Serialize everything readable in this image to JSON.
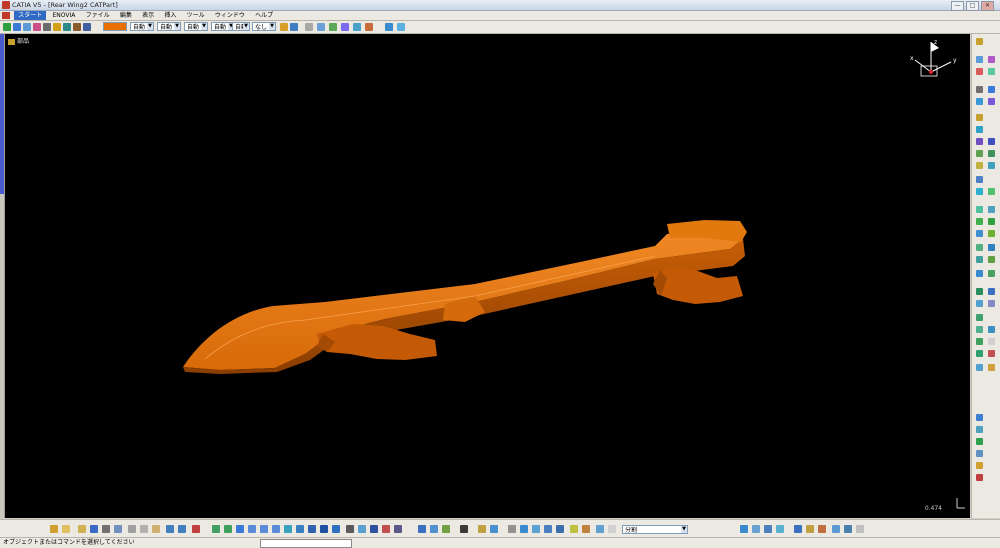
{
  "window": {
    "title": "CATIA V5 - [Rear Wing2 CATPart]",
    "minimize": "—",
    "maximize": "□",
    "close": "✕"
  },
  "menu": {
    "items": [
      "スタート",
      "ENOVIA",
      "ファイル",
      "編集",
      "表示",
      "挿入",
      "ツール",
      "ウィンドウ",
      "ヘルプ"
    ],
    "selected_index": 0
  },
  "top_toolbar": {
    "fill_color": "#e86f00",
    "combos": [
      {
        "value": "自動"
      },
      {
        "value": "自動"
      },
      {
        "value": "自動"
      },
      {
        "value": "自動"
      },
      {
        "value": "自動"
      },
      {
        "value": "なし"
      }
    ]
  },
  "tree": {
    "root_label": "部品"
  },
  "viewport": {
    "background": "#000000",
    "part_color": "#e8720c",
    "scale_value": "0.474"
  },
  "compass": {
    "x_label": "x",
    "y_label": "y",
    "z_label": "z"
  },
  "bottom_toolbar": {
    "workbench_combo": "分割"
  },
  "status": {
    "message": "オブジェクトまたはコマンドを選択してください"
  },
  "icons": [
    "rotate-icon",
    "pan-icon",
    "zoom-icon",
    "fit-all-icon",
    "normal-view-icon",
    "save-icon",
    "open-icon",
    "new-icon",
    "cut-icon",
    "copy-icon",
    "paste-icon",
    "undo-icon",
    "redo-icon",
    "sketch-icon",
    "pad-icon",
    "extrude-icon",
    "sweep-icon",
    "fill-icon",
    "join-icon",
    "split-icon",
    "trim-icon",
    "measure-icon"
  ]
}
